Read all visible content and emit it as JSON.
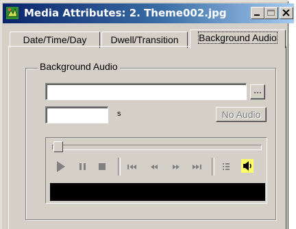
{
  "window": {
    "title": "Media Attributes: 2. Theme002.jpg",
    "title_color": "#ffffff",
    "titlebar_color": "#0a246a"
  },
  "tabs": [
    {
      "label": "Date/Time/Day",
      "active": false
    },
    {
      "label": "Dwell/Transition",
      "active": false
    },
    {
      "label": "Background Audio",
      "active": true
    }
  ],
  "group": {
    "legend": "Background Audio",
    "file_path_value": "",
    "browse_label": "...",
    "duration_value": "",
    "duration_unit": "s",
    "no_audio_label": "No Audio"
  },
  "player": {
    "position_fraction": 0,
    "controls": [
      "play-icon",
      "pause-icon",
      "stop-icon",
      "skip-back-icon",
      "rewind-icon",
      "fast-forward-icon",
      "skip-forward-icon",
      "playlist-icon",
      "speaker-icon"
    ],
    "display_color": "#000000"
  }
}
